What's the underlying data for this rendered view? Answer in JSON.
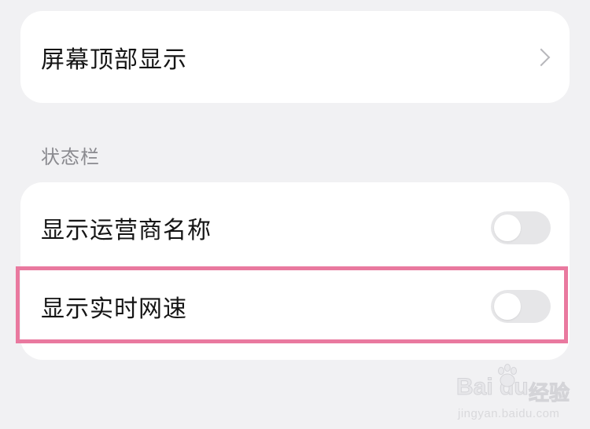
{
  "display_section": {
    "screen_top_display_label": "屏幕顶部显示"
  },
  "status_bar_section": {
    "header": "状态栏",
    "items": [
      {
        "label": "显示运营商名称",
        "enabled": false
      },
      {
        "label": "显示实时网速",
        "enabled": false
      }
    ]
  },
  "annotation": {
    "highlight_color": "#e9799f"
  },
  "watermark": {
    "logo_text": "Bai du",
    "cn_text": "经验",
    "url": "jingyan.baidu.com"
  },
  "colors": {
    "background": "#f1f1f3",
    "card": "#ffffff",
    "toggle_off": "#e6e6e8"
  }
}
